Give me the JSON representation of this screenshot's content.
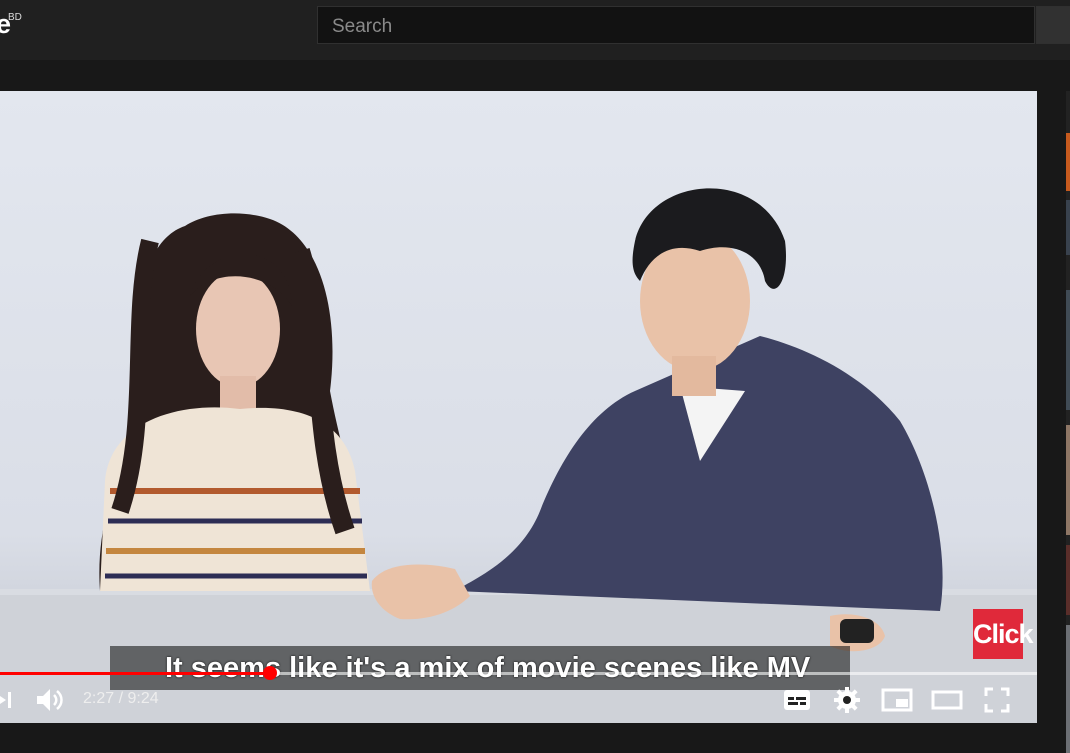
{
  "header": {
    "logo_fragment": "e",
    "region_badge": "BD",
    "search_placeholder": "Search"
  },
  "video": {
    "caption": "It seems like it's a mix of movie scenes like MV",
    "badge_label": "Click",
    "current_time": "2:27",
    "separator": "/",
    "duration": "9:24",
    "progress_fraction": 0.26,
    "buffered_fraction": 1.0
  },
  "controls": {
    "icons": [
      "next-icon",
      "volume-icon",
      "subtitles-icon",
      "settings-icon",
      "miniplayer-icon",
      "theater-icon",
      "fullscreen-icon"
    ]
  },
  "colors": {
    "accent": "#ff0000",
    "badge": "#e0293a",
    "background": "#181818",
    "topbar": "#202020"
  }
}
